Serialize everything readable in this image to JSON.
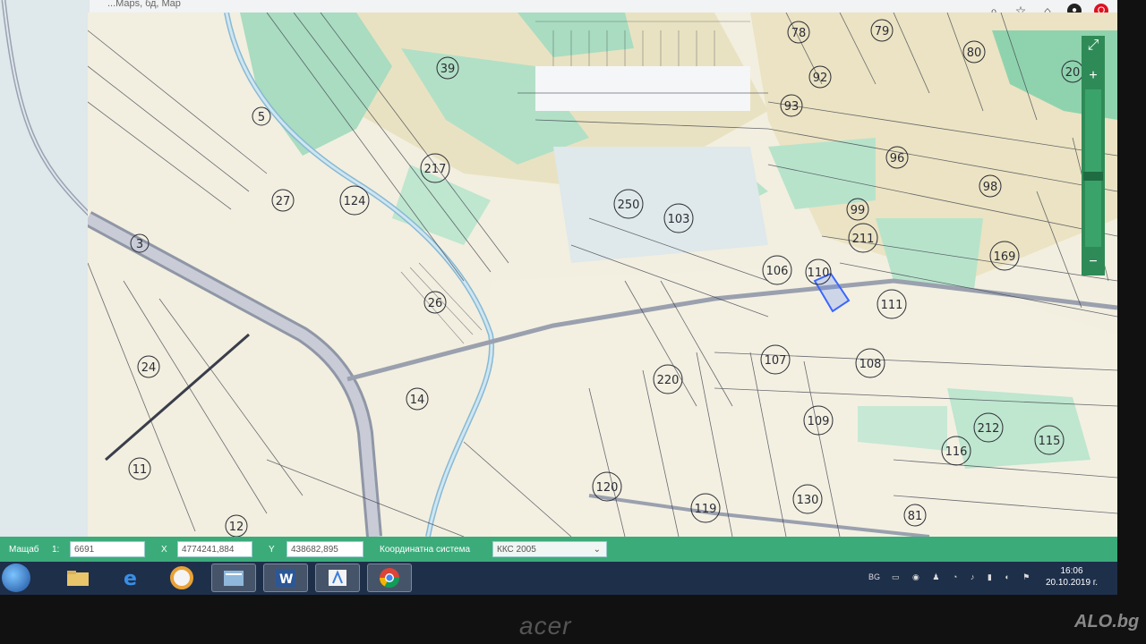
{
  "browser": {
    "url": "...Maps, бд, Map",
    "icons": [
      "search-icon",
      "star-icon",
      "extension-icon",
      "profile-icon",
      "opera-icon"
    ]
  },
  "map": {
    "parcel_labels": [
      "78",
      "79",
      "80",
      "20",
      "39",
      "92",
      "93",
      "5",
      "217",
      "96",
      "27",
      "124",
      "250",
      "103",
      "98",
      "99",
      "211",
      "169",
      "3",
      "106",
      "110",
      "26",
      "111",
      "24",
      "107",
      "108",
      "14",
      "220",
      "109",
      "212",
      "116",
      "115",
      "11",
      "120",
      "119",
      "130",
      "81",
      "12"
    ],
    "selected_parcel_color": "#3a66ff",
    "colors": {
      "land": "#eee9d1",
      "green": "#a7dfc2",
      "road": "#b8bcc8",
      "line": "#3a3d4a"
    }
  },
  "zoom": {
    "zoom_in": "+",
    "zoom_out": "−",
    "expand": "⤢"
  },
  "coords": {
    "scale_label": "Мащаб",
    "scale_prefix": "1:",
    "scale_value": "6691",
    "x_label": "X",
    "x_value": "4774241,884",
    "y_label": "Y",
    "y_value": "438682,895",
    "system_label": "Координатна система",
    "system_value": "ККС 2005"
  },
  "taskbar": {
    "apps": [
      "windows-explorer",
      "internet-explorer",
      "opera",
      "file-manager",
      "word",
      "paint",
      "chrome"
    ],
    "tray_lang": "BG",
    "time": "16:06",
    "date": "20.10.2019 г."
  },
  "monitor": {
    "brand": "acer",
    "watermark": "ALO.bg"
  }
}
